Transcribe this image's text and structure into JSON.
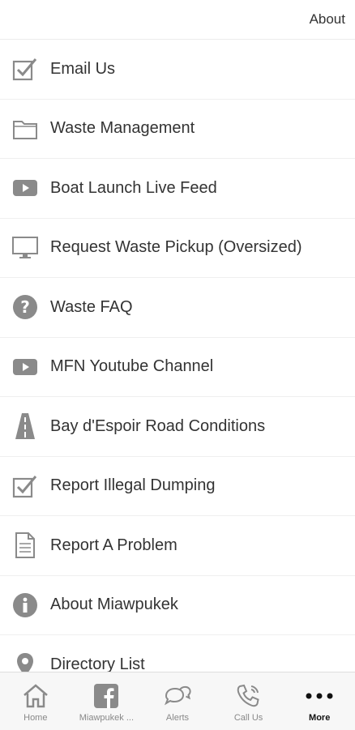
{
  "header": {
    "about_label": "About"
  },
  "menu": {
    "items": [
      {
        "label": "Email Us",
        "icon": "checkbox-icon"
      },
      {
        "label": "Waste Management",
        "icon": "folder-icon"
      },
      {
        "label": "Boat Launch Live Feed",
        "icon": "video-play-icon"
      },
      {
        "label": "Request Waste Pickup (Oversized)",
        "icon": "monitor-icon"
      },
      {
        "label": "Waste FAQ",
        "icon": "question-icon"
      },
      {
        "label": "MFN Youtube Channel",
        "icon": "video-play-icon"
      },
      {
        "label": "Bay d'Espoir Road Conditions",
        "icon": "road-icon"
      },
      {
        "label": "Report Illegal Dumping",
        "icon": "checkbox-icon"
      },
      {
        "label": "Report A Problem",
        "icon": "document-icon"
      },
      {
        "label": "About Miawpukek",
        "icon": "info-icon"
      },
      {
        "label": "Directory List",
        "icon": "map-pin-icon"
      }
    ]
  },
  "tabbar": {
    "tabs": [
      {
        "label": "Home",
        "icon": "home-icon"
      },
      {
        "label": "Miawpukek ...",
        "icon": "facebook-icon"
      },
      {
        "label": "Alerts",
        "icon": "chat-bubbles-icon"
      },
      {
        "label": "Call Us",
        "icon": "phone-icon"
      },
      {
        "label": "More",
        "icon": "more-dots-icon",
        "active": true
      }
    ]
  },
  "colors": {
    "icon_gray": "#8a8a8a",
    "text": "#333333",
    "divider": "#efefef"
  }
}
